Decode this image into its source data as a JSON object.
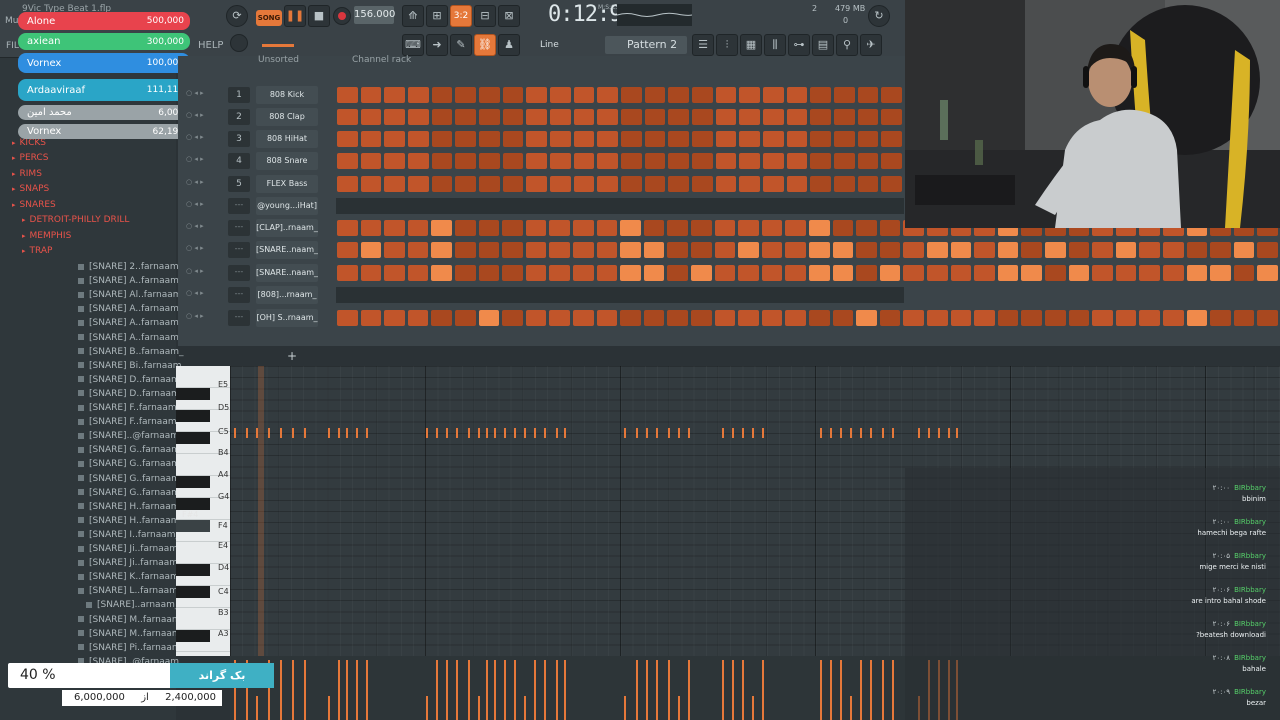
{
  "window": {
    "title": "9Vic Type Beat 1.flp",
    "menu_label": "Mu",
    "file_label": "FIL",
    "help_label": "HELP"
  },
  "transport": {
    "song_label": "SONG",
    "tempo": "156.000",
    "time": "0:12:99",
    "time_unit": "M:S:CS",
    "memory": "479 MB",
    "cpu_left": "2",
    "cpu_right": "0"
  },
  "toolbar": {
    "snap_label": "Line",
    "pattern_label": "Pattern 2"
  },
  "donations": [
    {
      "name": "Alone",
      "amount": "500,000",
      "color": "#e8434d"
    },
    {
      "name": "axiean",
      "amount": "300,000",
      "color": "#3ec478"
    },
    {
      "name": "Vornex",
      "amount": "100,000",
      "color": "#2f8ee0"
    },
    {
      "name": "Ardaaviraaf",
      "amount": "111,111",
      "color": "#2aa5c7"
    },
    {
      "name": "محمد امین",
      "amount": "6,000",
      "color": "#9aa3a7"
    },
    {
      "name": "Vornex",
      "amount": "62,199",
      "color": "#9aa3a7"
    }
  ],
  "browser": {
    "folders": [
      "KICKS",
      "PERCS",
      "RIMS",
      "SNAPS",
      "SNARES",
      "DETROIT-PHILLY DRILL",
      "MEMPHIS",
      "TRAP"
    ],
    "files": [
      "[SNARE] 2..farnaam_",
      "[SNARE] A..farnaam_",
      "[SNARE] Al..farnaam_",
      "[SNARE] A..farnaam_",
      "[SNARE] A..farnaam_",
      "[SNARE] A..farnaam_",
      "[SNARE] B..farnaam_",
      "[SNARE] Bi..farnaam_",
      "[SNARE] D..farnaam_",
      "[SNARE] D..farnaam_",
      "[SNARE] F..farnaam_",
      "[SNARE] F..farnaam_",
      "[SNARE]..@farnaam_",
      "[SNARE] G..farnaam_",
      "[SNARE] G..farnaam_",
      "[SNARE] G..farnaam_",
      "[SNARE] G..farnaam_",
      "[SNARE] H..farnaam_",
      "[SNARE] H..farnaam_",
      "[SNARE] I..farnaam_",
      "[SNARE] Ji..farnaam_",
      "[SNARE] Ji..farnaam_",
      "[SNARE] K..farnaam_",
      "[SNARE] L..farnaam_",
      "[SNARE]..arnaam_",
      "[SNARE] M..farnaam_",
      "[SNARE] M..farnaam_",
      "[SNARE] Pi..farnaam_",
      "[SNARE]..@farnaam_"
    ]
  },
  "channel_rack": {
    "title": "Channel rack",
    "filter": "Unsorted",
    "channels": [
      {
        "num": "1",
        "name": "808 Kick"
      },
      {
        "num": "2",
        "name": "808 Clap"
      },
      {
        "num": "3",
        "name": "808 HiHat"
      },
      {
        "num": "4",
        "name": "808 Snare"
      },
      {
        "num": "5",
        "name": "FLEX Bass"
      },
      {
        "num": "---",
        "name": "@young...iHat]"
      },
      {
        "num": "---",
        "name": "[CLAP]..rnaam_"
      },
      {
        "num": "---",
        "name": "[SNARE..naam_"
      },
      {
        "num": "---",
        "name": "[SNARE..naam_"
      },
      {
        "num": "---",
        "name": "[808]...rnaam_"
      },
      {
        "num": "---",
        "name": "[OH] S..rnaam_"
      }
    ]
  },
  "piano_roll": {
    "keys": [
      "E5",
      "D5",
      "C5",
      "B4",
      "A4",
      "G4",
      "F#4",
      "F4",
      "E4",
      "D4",
      "C4",
      "B3",
      "A3"
    ]
  },
  "chat": [
    {
      "user": "BIRbbary",
      "time": "۲۰:۰۰",
      "msg": "bbinim"
    },
    {
      "user": "BIRbbary",
      "time": "۲۰:۰۰",
      "msg": "hamechi bega rafte"
    },
    {
      "user": "BIRbbary",
      "time": "۲۰:۰۵",
      "msg": "mige merci ke nisti"
    },
    {
      "user": "BIRbbary",
      "time": "۲۰:۰۶",
      "msg": "are intro bahal shode"
    },
    {
      "user": "BIRbbary",
      "time": "۲۰:۰۶",
      "msg": "?beatesh downloadi"
    },
    {
      "user": "BIRbbary",
      "time": "۲۰:۰۸",
      "msg": "bahale"
    },
    {
      "user": "BIRbbary",
      "time": "۲۰:۰۹",
      "msg": "bezar"
    }
  ],
  "goal": {
    "percent": "40 %",
    "label": "بک گراند",
    "total": "6,000,000",
    "of": "از",
    "current": "2,400,000"
  }
}
